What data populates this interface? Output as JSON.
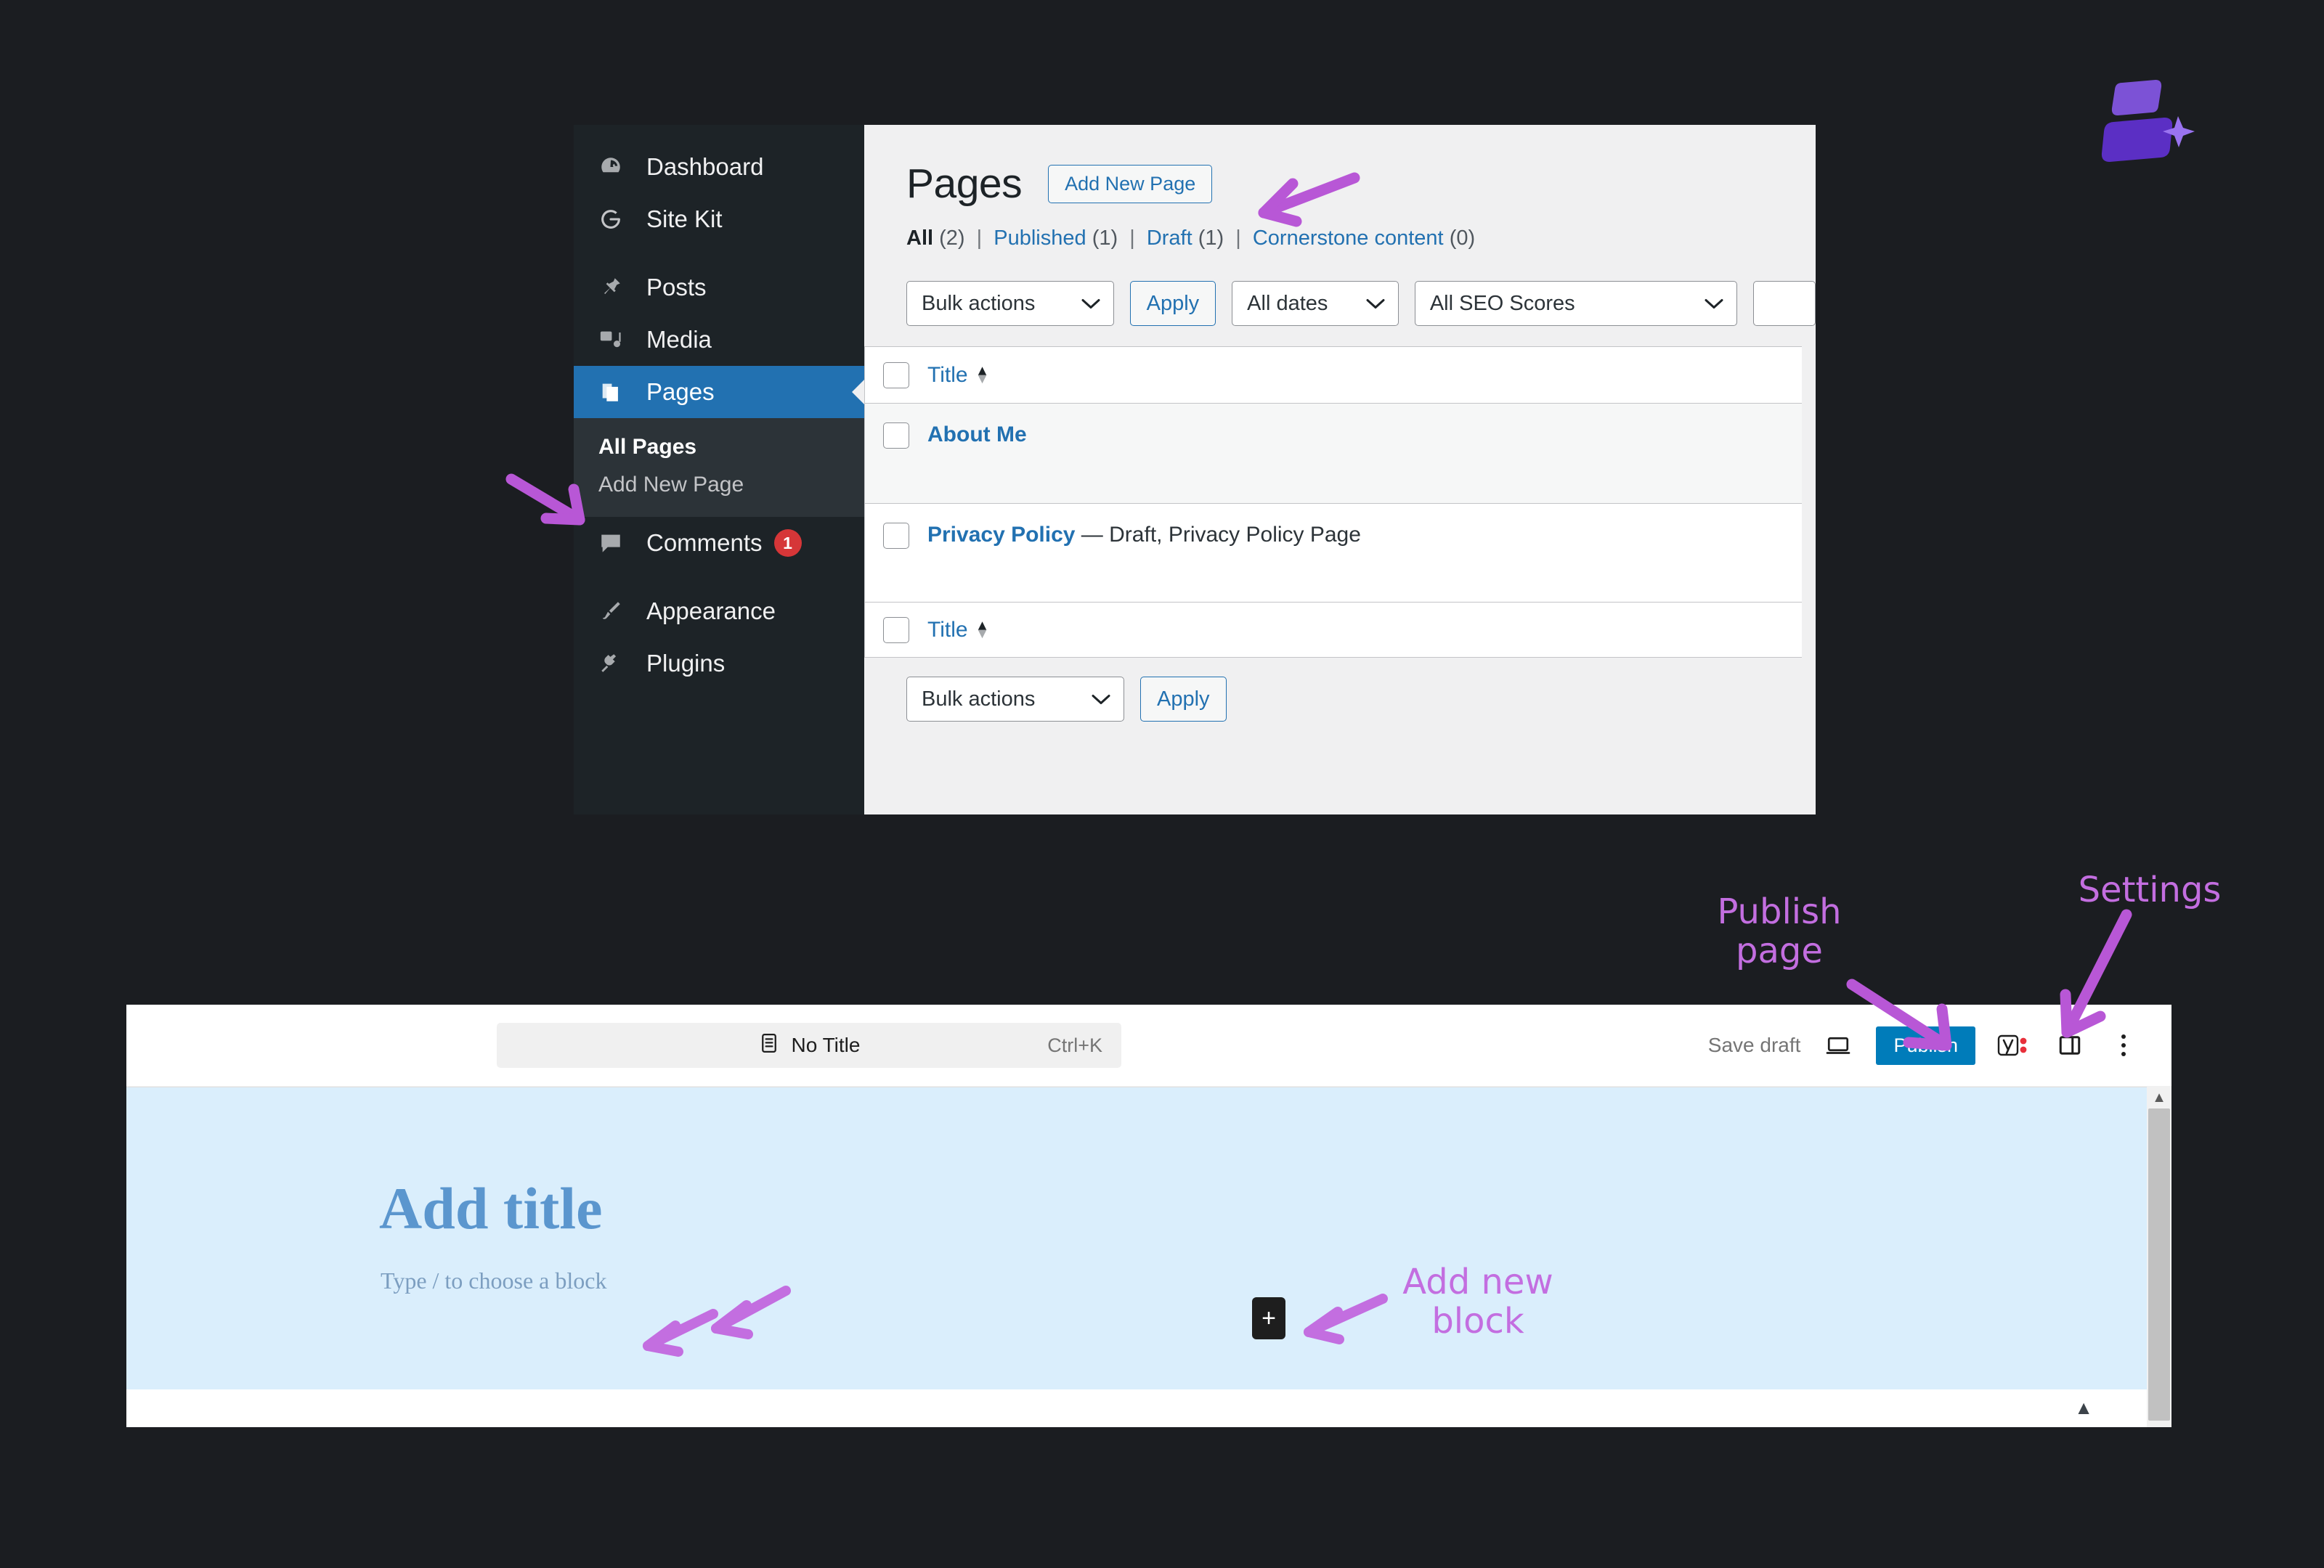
{
  "brand": {
    "logo_name": "sparkle-blocks-logo",
    "colors": {
      "light": "#7c52d6",
      "dark": "#5b2fc4",
      "star": "#9a73f0"
    }
  },
  "wp_admin": {
    "sidebar": {
      "items": [
        {
          "label": "Dashboard",
          "icon": "dashboard-icon",
          "active": false
        },
        {
          "label": "Site Kit",
          "icon": "google-g-icon",
          "active": false
        },
        {
          "label": "Posts",
          "icon": "pin-icon",
          "active": false
        },
        {
          "label": "Media",
          "icon": "media-icon",
          "active": false
        },
        {
          "label": "Pages",
          "icon": "pages-icon",
          "active": true
        },
        {
          "label": "Comments",
          "icon": "comment-icon",
          "active": false,
          "badge": "1"
        },
        {
          "label": "Appearance",
          "icon": "brush-icon",
          "active": false
        },
        {
          "label": "Plugins",
          "icon": "plug-icon",
          "active": false
        }
      ],
      "submenu": [
        {
          "label": "All Pages",
          "current": true
        },
        {
          "label": "Add New Page",
          "current": false
        }
      ]
    },
    "page": {
      "title": "Pages",
      "add_new_button": "Add New Page",
      "filters": [
        {
          "label": "All",
          "count": "(2)",
          "current": true
        },
        {
          "label": "Published",
          "count": "(1)",
          "current": false
        },
        {
          "label": "Draft",
          "count": "(1)",
          "current": false
        },
        {
          "label": "Cornerstone content",
          "count": "(0)",
          "current": false
        }
      ],
      "separator": "|",
      "toolbar": {
        "bulk_actions": "Bulk actions",
        "apply": "Apply",
        "all_dates": "All dates",
        "all_seo_scores": "All SEO Scores"
      },
      "table": {
        "column_header": "Title",
        "rows": [
          {
            "title": "About Me",
            "meta": ""
          },
          {
            "title": "Privacy Policy",
            "meta": " — Draft, Privacy Policy Page"
          }
        ]
      },
      "toolbar_bottom": {
        "bulk_actions": "Bulk actions",
        "apply": "Apply"
      }
    }
  },
  "editor": {
    "document_chip": {
      "label": "No Title",
      "shortcut": "Ctrl+K",
      "icon": "document-icon"
    },
    "actions": {
      "save_draft": "Save draft",
      "preview_icon": "desktop-preview-icon",
      "publish": "Publish",
      "yoast_icon": "yoast-seo-icon",
      "settings_icon": "sidebar-toggle-icon",
      "options_icon": "kebab-menu-icon"
    },
    "canvas": {
      "title_placeholder": "Add title",
      "block_placeholder": "Type / to choose a block",
      "add_block_label": "+"
    },
    "accent_color": "#007cba",
    "canvas_bg": "#daeefc"
  },
  "annotations": [
    {
      "id": "publish-page",
      "text": "Publish\npage"
    },
    {
      "id": "settings",
      "text": "Settings"
    },
    {
      "id": "add-new-block",
      "text": "Add new\nblock"
    }
  ],
  "annotation_color": "#c36ee0"
}
